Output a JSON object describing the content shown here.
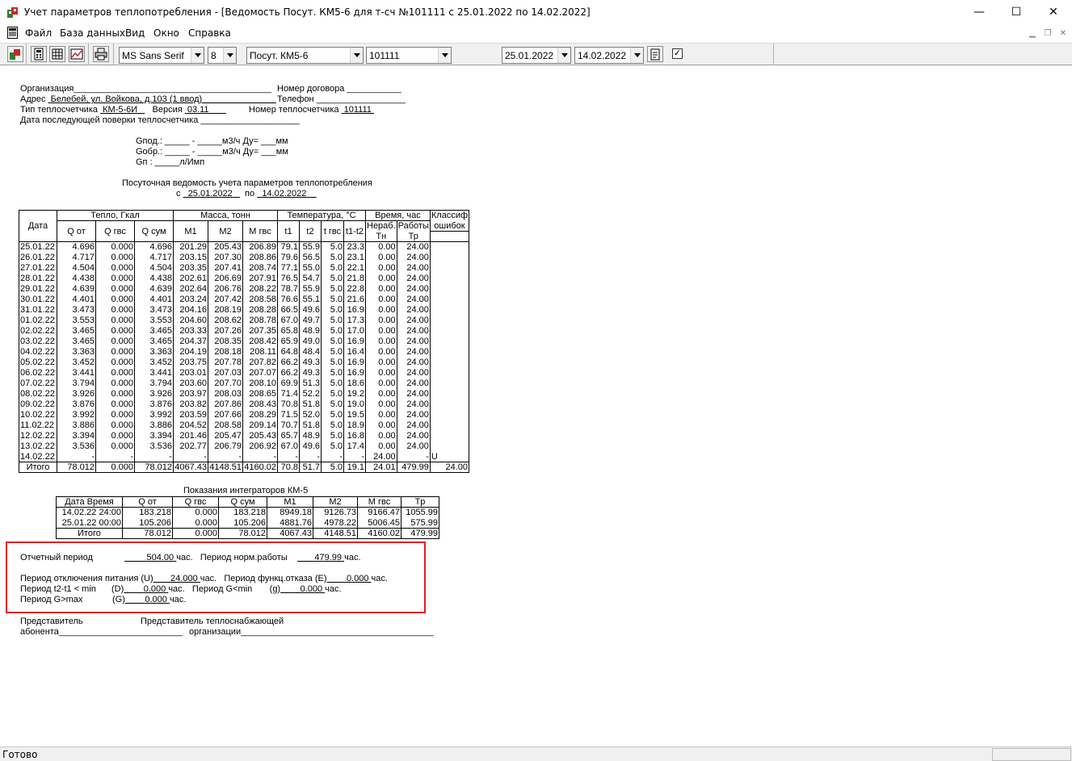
{
  "window": {
    "title": "Учет параметров теплопотребления - [Ведомость Посут. КМ5-6 для т-сч №101111 с 25.01.2022 по 14.02.2022]",
    "minimize": "—",
    "maximize": "☐",
    "close": "✕"
  },
  "menu": [
    "Файл",
    "База данных",
    "Вид",
    "Окно",
    "Справка"
  ],
  "toolbar": {
    "font": "MS Sans Serif",
    "size": "8",
    "report": "Посут. КМ5-6",
    "meter": "101111",
    "date_from": "25.01.2022",
    "date_to": "14.02.2022",
    "checkbox": "✓"
  },
  "header": {
    "org_label": "Организация",
    "contract_label": "Номер договора",
    "address_label": "Адрес",
    "address_value": "Белебей, ул. Войкова, д.103 (1 ввод)",
    "phone_label": "Телефон",
    "meter_type_label": "Тип теплосчетчика",
    "meter_type_value": "КМ-5-6И",
    "version_label": "Версия",
    "version_value": "03.11",
    "meter_no_label": "Номер теплосчетчика",
    "meter_no_value": "101111",
    "verify_label": "Дата последующей поверки теплосчетчика",
    "gpod": "Gпод.: _____ - _____м3/ч  Ду= ___мм",
    "gobr": "Gобр.: _____ - _____м3/ч  Ду= ___мм",
    "gp": "Gп   :  _____л/Имп",
    "report_title": "Посуточная ведомость учета параметров теплопотребления",
    "period_from_label": "с",
    "period_from": "25.01.2022",
    "period_to_label": "по",
    "period_to": "14.02.2022"
  },
  "table": {
    "groups": [
      "Дата",
      "Тепло, Гкал",
      "Масса, тонн",
      "Температура, °С",
      "Время, час",
      "Классиф"
    ],
    "columns": [
      "Q от",
      "Q гвс",
      "Q сум",
      "M1",
      "M2",
      "M гвс",
      "t1",
      "t2",
      "t гвс",
      "t1-t2",
      "Нераб.",
      "Работы",
      "ошибок"
    ],
    "sub": [
      "Тн",
      "Тр"
    ],
    "rows": [
      [
        "25.01.22",
        "4.696",
        "0.000",
        "4.696",
        "201.29",
        "205.43",
        "206.89",
        "79.1",
        "55.9",
        "5.0",
        "23.3",
        "0.00",
        "24.00",
        ""
      ],
      [
        "26.01.22",
        "4.717",
        "0.000",
        "4.717",
        "203.15",
        "207.30",
        "208.86",
        "79.6",
        "56.5",
        "5.0",
        "23.1",
        "0.00",
        "24.00",
        ""
      ],
      [
        "27.01.22",
        "4.504",
        "0.000",
        "4.504",
        "203.35",
        "207.41",
        "208.74",
        "77.1",
        "55.0",
        "5.0",
        "22.1",
        "0.00",
        "24.00",
        ""
      ],
      [
        "28.01.22",
        "4.438",
        "0.000",
        "4.438",
        "202.61",
        "206.69",
        "207.91",
        "76.5",
        "54.7",
        "5.0",
        "21.8",
        "0.00",
        "24.00",
        ""
      ],
      [
        "29.01.22",
        "4.639",
        "0.000",
        "4.639",
        "202.64",
        "206.76",
        "208.22",
        "78.7",
        "55.9",
        "5.0",
        "22.8",
        "0.00",
        "24.00",
        ""
      ],
      [
        "30.01.22",
        "4.401",
        "0.000",
        "4.401",
        "203.24",
        "207.42",
        "208.58",
        "76.6",
        "55.1",
        "5.0",
        "21.6",
        "0.00",
        "24.00",
        ""
      ],
      [
        "31.01.22",
        "3.473",
        "0.000",
        "3.473",
        "204.16",
        "208.19",
        "208.28",
        "66.5",
        "49.6",
        "5.0",
        "16.9",
        "0.00",
        "24.00",
        ""
      ],
      [
        "01.02.22",
        "3.553",
        "0.000",
        "3.553",
        "204.60",
        "208.62",
        "208.78",
        "67.0",
        "49.7",
        "5.0",
        "17.3",
        "0.00",
        "24.00",
        ""
      ],
      [
        "02.02.22",
        "3.465",
        "0.000",
        "3.465",
        "203.33",
        "207.26",
        "207.35",
        "65.8",
        "48.9",
        "5.0",
        "17.0",
        "0.00",
        "24.00",
        ""
      ],
      [
        "03.02.22",
        "3.465",
        "0.000",
        "3.465",
        "204.37",
        "208.35",
        "208.42",
        "65.9",
        "49.0",
        "5.0",
        "16.9",
        "0.00",
        "24.00",
        ""
      ],
      [
        "04.02.22",
        "3.363",
        "0.000",
        "3.363",
        "204.19",
        "208.18",
        "208.11",
        "64.8",
        "48.4",
        "5.0",
        "16.4",
        "0.00",
        "24.00",
        ""
      ],
      [
        "05.02.22",
        "3.452",
        "0.000",
        "3.452",
        "203.75",
        "207.78",
        "207.82",
        "66.2",
        "49.3",
        "5.0",
        "16.9",
        "0.00",
        "24.00",
        ""
      ],
      [
        "06.02.22",
        "3.441",
        "0.000",
        "3.441",
        "203.01",
        "207.03",
        "207.07",
        "66.2",
        "49.3",
        "5.0",
        "16.9",
        "0.00",
        "24.00",
        ""
      ],
      [
        "07.02.22",
        "3.794",
        "0.000",
        "3.794",
        "203.60",
        "207.70",
        "208.10",
        "69.9",
        "51.3",
        "5.0",
        "18.6",
        "0.00",
        "24.00",
        ""
      ],
      [
        "08.02.22",
        "3.926",
        "0.000",
        "3.926",
        "203.97",
        "208.03",
        "208.65",
        "71.4",
        "52.2",
        "5.0",
        "19.2",
        "0.00",
        "24.00",
        ""
      ],
      [
        "09.02.22",
        "3.876",
        "0.000",
        "3.876",
        "203.82",
        "207.86",
        "208.43",
        "70.8",
        "51.8",
        "5.0",
        "19.0",
        "0.00",
        "24.00",
        ""
      ],
      [
        "10.02.22",
        "3.992",
        "0.000",
        "3.992",
        "203.59",
        "207.66",
        "208.29",
        "71.5",
        "52.0",
        "5.0",
        "19.5",
        "0.00",
        "24.00",
        ""
      ],
      [
        "11.02.22",
        "3.886",
        "0.000",
        "3.886",
        "204.52",
        "208.58",
        "209.14",
        "70.7",
        "51.8",
        "5.0",
        "18.9",
        "0.00",
        "24.00",
        ""
      ],
      [
        "12.02.22",
        "3.394",
        "0.000",
        "3.394",
        "201.46",
        "205.47",
        "205.43",
        "65.7",
        "48.9",
        "5.0",
        "16.8",
        "0.00",
        "24.00",
        ""
      ],
      [
        "13.02.22",
        "3.536",
        "0.000",
        "3.536",
        "202.77",
        "206.79",
        "206.92",
        "67.0",
        "49.6",
        "5.0",
        "17.4",
        "0.00",
        "24.00",
        ""
      ],
      [
        "14.02.22",
        "-",
        "-",
        "-",
        "-",
        "-",
        "-",
        "-",
        "-",
        "-",
        "-",
        "24.00",
        "-",
        "U"
      ]
    ],
    "total": [
      "Итого",
      "78.012",
      "0.000",
      "78.012",
      "4067.43",
      "4148.51",
      "4160.02",
      "70.8",
      "51.7",
      "5.0",
      "19.1",
      "24.01",
      "479.99",
      "24.00"
    ]
  },
  "integrators": {
    "title": "Показания интеграторов КМ-5",
    "columns": [
      "Дата Время",
      "Q от",
      "Q гвс",
      "Q сум",
      "M1",
      "M2",
      "M гвс",
      "Tp"
    ],
    "rows": [
      [
        "14.02.22 24:00",
        "183.218",
        "0.000",
        "183.218",
        "8949.18",
        "9126.73",
        "9166.47",
        "1055.99"
      ],
      [
        "25.01.22 00:00",
        "105.206",
        "0.000",
        "105.206",
        "4881.76",
        "4978.22",
        "5006.45",
        "575.99"
      ]
    ],
    "total": [
      "Итого",
      "78.012",
      "0.000",
      "78.012",
      "4067.43",
      "4148.51",
      "4160.02",
      "479.99"
    ]
  },
  "summary": {
    "report_period_label": "Отчетный период",
    "report_period_value": "504.00",
    "norm_label": "Период норм.работы",
    "norm_value": "479.99",
    "hours": "час.",
    "power_label": "Период отключения питания (U)",
    "power_value": "24.000",
    "func_label": "Период функц.отказа (E)",
    "func_value": "0.000",
    "t_label": "Период t2-t1 < min",
    "t_code": "(D)",
    "t_value": "0.000",
    "gmin_label": "Период G<min",
    "gmin_code": "(g)",
    "gmin_value": "0.000",
    "gmax_label": "Период G>max",
    "gmax_code": "(G)",
    "gmax_value": "0.000"
  },
  "signatures": {
    "left1": "Представитель",
    "left2": "абонента",
    "right1": "Представитель теплоснабжающей",
    "right2": "организации"
  },
  "status": "Готово"
}
